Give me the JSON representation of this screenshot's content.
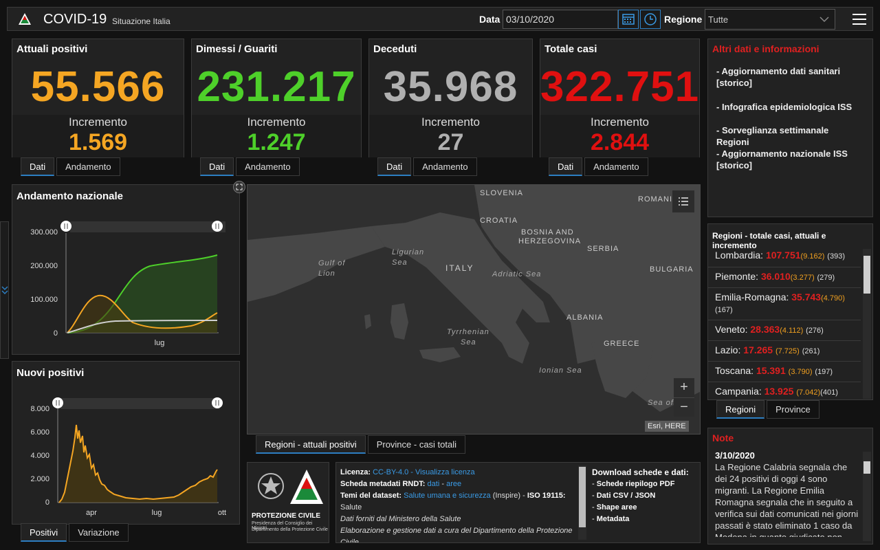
{
  "header": {
    "title": "COVID-19",
    "subtitle": "Situazione Italia",
    "date_label": "Data",
    "date_value": "03/10/2020",
    "region_label": "Regione",
    "region_value": "Tutte"
  },
  "kpis": [
    {
      "title": "Attuali positivi",
      "value": "55.566",
      "inc_label": "Incremento",
      "inc_value": "1.569",
      "color": "#f5a623"
    },
    {
      "title": "Dimessi / Guariti",
      "value": "231.217",
      "inc_label": "Incremento",
      "inc_value": "1.247",
      "color": "#4ed02a"
    },
    {
      "title": "Deceduti",
      "value": "35.968",
      "inc_label": "Incremento",
      "inc_value": "27",
      "color": "#b0b0b0"
    },
    {
      "title": "Totale casi",
      "value": "322.751",
      "inc_label": "Incremento",
      "inc_value": "2.844",
      "color": "#e01010"
    }
  ],
  "kpi_tabs": {
    "dati": "Dati",
    "andamento": "Andamento"
  },
  "info": {
    "title": "Altri dati e informazioni",
    "items": [
      "- Aggiornamento dati sanitari [storico]",
      "- Infografica epidemiologica ISS",
      "- Sorveglianza settimanale Regioni",
      "- Aggiornamento nazionale ISS [storico]"
    ]
  },
  "andamento": {
    "title": "Andamento nazionale",
    "yticks": [
      "300.000",
      "200.000",
      "100.000",
      "0"
    ],
    "xtick": "lug"
  },
  "nuovi": {
    "title": "Nuovi positivi",
    "yticks": [
      "8.000",
      "6.000",
      "4.000",
      "2.000",
      "0"
    ],
    "xticks": [
      "apr",
      "lug",
      "ott"
    ],
    "tabs": [
      "Positivi",
      "Variazione"
    ]
  },
  "map": {
    "labels": [
      "SLOVENIA",
      "ROMANI",
      "CROATIA",
      "BOSNIA AND",
      "HERZEGOVINA",
      "SERBIA",
      "BULGARIA",
      "ITALY",
      "Adriatic Sea",
      "Ligurian",
      "Sea",
      "Gulf of",
      "Lion",
      "ALBANIA",
      "GREECE",
      "Tyrrhenian",
      "Sea",
      "Ionian Sea",
      "Sea of"
    ],
    "attribution": "Esri, HERE",
    "zoom_in": "+",
    "zoom_out": "−",
    "tabs": [
      "Regioni - attuali positivi",
      "Province - casi totali"
    ]
  },
  "regions": {
    "title": "Regioni - totale casi, attuali e incremento",
    "rows": [
      {
        "name": "Lombardia:",
        "tot": "107.751",
        "att": "(9.162)",
        "inc": "(393)"
      },
      {
        "name": "Piemonte:",
        "tot": "36.010",
        "att": "(3.277)",
        "inc": "(279)"
      },
      {
        "name": "Emilia-Romagna:",
        "tot": "35.743",
        "att": "(4.790)",
        "inc": "(167)"
      },
      {
        "name": "Veneto:",
        "tot": "28.363",
        "att": "(4.112)",
        "inc": "(276)"
      },
      {
        "name": "Lazio:",
        "tot": "17.265",
        "att": "(7.725)",
        "inc": "(261)"
      },
      {
        "name": "Toscana:",
        "tot": "15.391",
        "att": "(3.790)",
        "inc": "(197)"
      },
      {
        "name": "Campania:",
        "tot": "13.925",
        "att": "(7.042)",
        "inc": "(401)"
      }
    ],
    "tabs": [
      "Regioni",
      "Province"
    ]
  },
  "note": {
    "title": "Note",
    "date": "3/10/2020",
    "text": "La Regione Calabria segnala che dei 24 positivi di oggi 4 sono migranti. La Regione Emilia Romagna segnala che in seguito a verifica sui dati comunicati nei giorni passati è stato eliminato 1 caso da Modena in quanto giudicato non caso"
  },
  "footer": {
    "logo_caption1": "PROTEZIONE CIVILE",
    "logo_caption2": "Presidenza del Consiglio dei Ministri",
    "logo_caption3": "Dipartimento della Protezione Civile",
    "lic_label": "Licenza:",
    "lic_value": "CC-BY-4.0",
    "lic_sep": " - ",
    "lic_link": "Visualizza licenza",
    "meta_label": "Scheda metadati RNDT:",
    "meta_l1": "dati",
    "meta_l2": "aree",
    "temi_label": "Temi del dataset:",
    "temi_link": "Salute umana e sicurezza",
    "temi_rest": " (Inspire) - ",
    "temi_iso": "ISO 19115:",
    "temi_salute": "Salute",
    "line_dati": "Dati forniti dal Ministero della Salute",
    "line_elab": "Elaborazione e gestione dati a cura del Dipartimento della Protezione Civile",
    "download_title": "Download schede e dati:",
    "downloads": [
      "Schede riepilogo PDF",
      "Dati CSV / JSON",
      "Shape aree",
      "Metadata"
    ]
  }
}
